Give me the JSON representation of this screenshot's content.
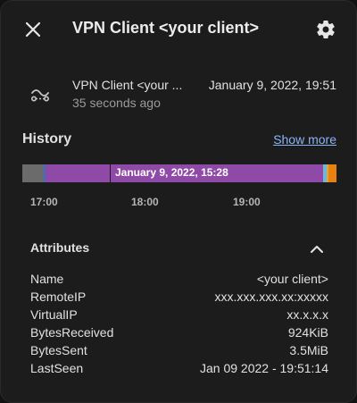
{
  "header": {
    "title": "VPN Client <your client>",
    "close_icon": "close-icon",
    "settings_icon": "gear-icon"
  },
  "entity": {
    "icon": "vpn-icon",
    "name": "VPN Client <your client>",
    "name_display": "VPN Client <your ...",
    "state": "January 9, 2022, 19:51",
    "last_changed": "35 seconds ago"
  },
  "history": {
    "title": "History",
    "show_more": "Show more",
    "bar_label": "January 9, 2022, 15:28",
    "ticks": [
      "17:00",
      "18:00",
      "19:00"
    ],
    "colors": {
      "gray": "#6b6b6b",
      "blue": "#3a6fc4",
      "purple": "#8f4aa8",
      "light_blue": "#6fb6d8",
      "orange": "#e8820f",
      "gold": "#d7a84a"
    }
  },
  "attributes": {
    "title": "Attributes",
    "rows": [
      {
        "key": "Name",
        "value": "<your client>"
      },
      {
        "key": "RemoteIP",
        "value": "xxx.xxx.xxx.xx:xxxxx"
      },
      {
        "key": "VirtualIP",
        "value": "xx.x.x.x"
      },
      {
        "key": "BytesReceived",
        "value": "924KiB"
      },
      {
        "key": "BytesSent",
        "value": "3.5MiB"
      },
      {
        "key": "LastSeen",
        "value": "Jan 09 2022 - 19:51:14"
      }
    ]
  }
}
